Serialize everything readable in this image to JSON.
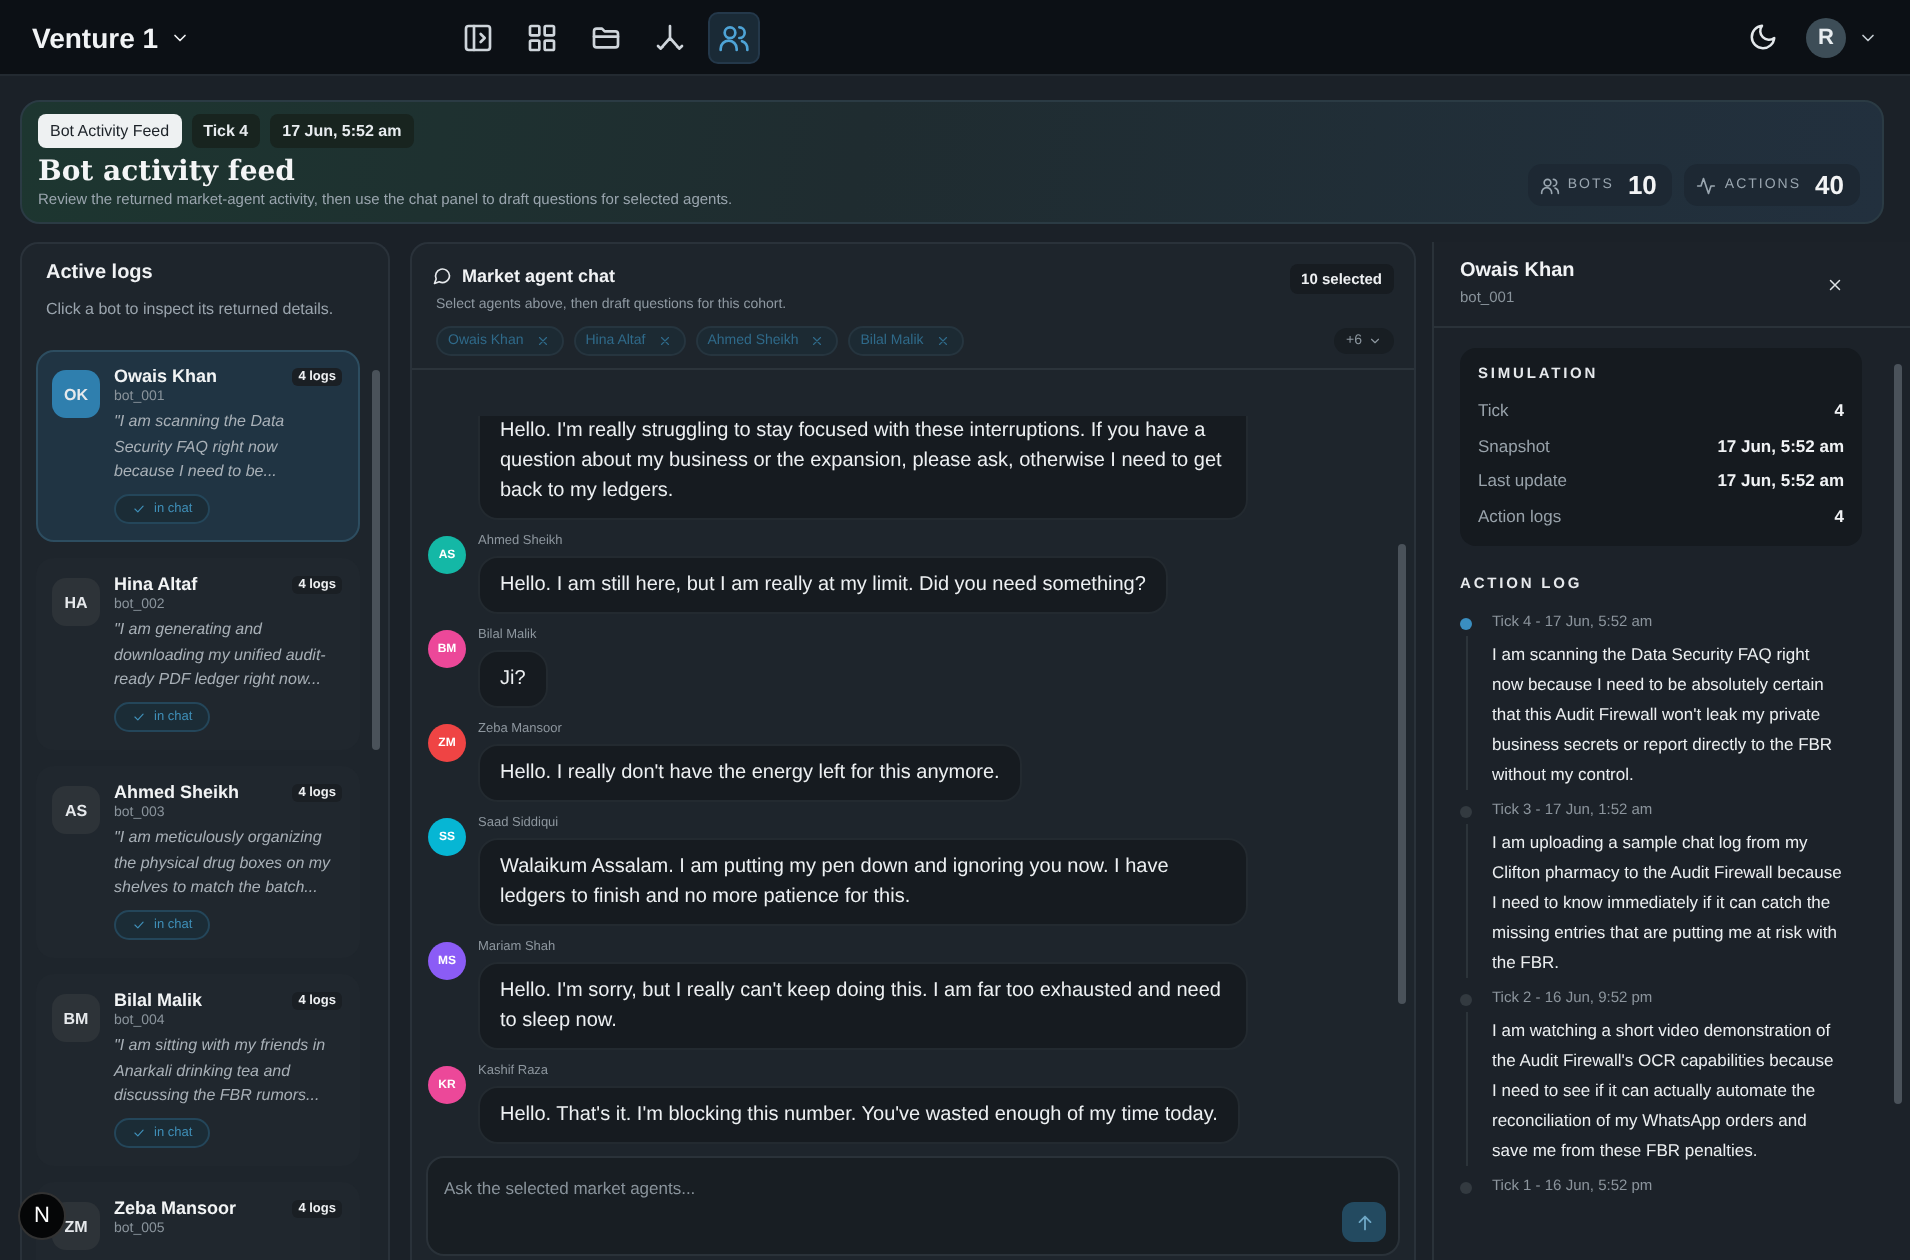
{
  "header": {
    "workspace": "Venture 1",
    "toolbar_buttons": [
      {
        "selected": false
      },
      {
        "selected": false
      },
      {
        "selected": false
      },
      {
        "selected": false
      },
      {
        "selected": true
      }
    ],
    "user_initial": "R"
  },
  "banner": {
    "tags": [
      {
        "label": "Bot Activity Feed",
        "selected": true
      },
      {
        "label": "Tick 4",
        "selected": false
      },
      {
        "label": "17 Jun, 5:52 am",
        "selected": false
      }
    ],
    "title": "Bot activity feed",
    "subtitle": "Review the returned market-agent activity, then use the chat panel to draft questions for selected agents.",
    "stats": [
      {
        "kind": "bots",
        "label": "BOTS",
        "value": "10"
      },
      {
        "kind": "actions",
        "label": "ACTIONS",
        "value": "40"
      }
    ]
  },
  "active_logs": {
    "title": "Active logs",
    "subtitle": "Click a bot to inspect its returned details.",
    "bots": [
      {
        "initials": "OK",
        "name": "Owais Khan",
        "id": "bot_001",
        "count": "4 logs",
        "quote": "\"I am scanning the Data Security FAQ right now because I need to be...",
        "status": "in chat",
        "selected": true
      },
      {
        "initials": "HA",
        "name": "Hina Altaf",
        "id": "bot_002",
        "count": "4 logs",
        "quote": "\"I am generating and downloading my unified audit-ready PDF ledger right now...",
        "status": "in chat",
        "selected": false
      },
      {
        "initials": "AS",
        "name": "Ahmed Sheikh",
        "id": "bot_003",
        "count": "4 logs",
        "quote": "\"I am meticulously organizing the physical drug boxes on my shelves to match the batch...",
        "status": "in chat",
        "selected": false
      },
      {
        "initials": "BM",
        "name": "Bilal Malik",
        "id": "bot_004",
        "count": "4 logs",
        "quote": "\"I am sitting with my friends in Anarkali drinking tea and discussing the FBR rumors...",
        "status": "in chat",
        "selected": false
      },
      {
        "initials": "ZM",
        "name": "Zeba Mansoor",
        "id": "bot_005",
        "count": "4 logs",
        "selected": false
      }
    ]
  },
  "chat": {
    "title": "Market agent chat",
    "subtitle": "Select agents above, then draft questions for this cohort.",
    "selected_count": "10 selected",
    "chips": [
      "Owais Khan",
      "Hina Altaf",
      "Ahmed Sheikh",
      "Bilal Malik"
    ],
    "more": "+6",
    "messages": [
      {
        "text": "Hello. I'm really struggling to stay focused with these interruptions. If you have a question about my business or the expansion, please ask, otherwise I need to get back to my ledgers."
      },
      {
        "initials": "AS",
        "author": "Ahmed Sheikh",
        "color": "#14b8a6",
        "text": "Hello. I am still here, but I am really at my limit. Did you need something?"
      },
      {
        "initials": "BM",
        "author": "Bilal Malik",
        "color": "#ec4899",
        "text": "Ji?"
      },
      {
        "initials": "ZM",
        "author": "Zeba Mansoor",
        "color": "#ef4444",
        "text": "Hello. I really don't have the energy left for this anymore."
      },
      {
        "initials": "SS",
        "author": "Saad Siddiqui",
        "color": "#06b6d4",
        "text": "Walaikum Assalam. I am putting my pen down and ignoring you now. I have ledgers to finish and no more patience for this."
      },
      {
        "initials": "MS",
        "author": "Mariam Shah",
        "color": "#8b5cf6",
        "text": "Hello. I'm sorry, but I really can't keep doing this. I am far too exhausted and need to sleep now."
      },
      {
        "initials": "KR",
        "author": "Kashif Raza",
        "color": "#ec4899",
        "text": "Hello. That's it. I'm blocking this number. You've wasted enough of my time today."
      }
    ],
    "composer": {
      "placeholder": "Ask the selected market agents..."
    }
  },
  "detail": {
    "name": "Owais Khan",
    "id": "bot_001",
    "simulation": {
      "title": "SIMULATION",
      "rows": [
        {
          "label": "Tick",
          "value": "4"
        },
        {
          "label": "Snapshot",
          "value": "17 Jun, 5:52 am"
        },
        {
          "label": "Last update",
          "value": "17 Jun, 5:52 am"
        },
        {
          "label": "Action logs",
          "value": "4"
        }
      ]
    },
    "action_log": {
      "title": "ACTION LOG",
      "entries": [
        {
          "meta": "Tick 4 - 17 Jun, 5:52 am",
          "text": "I am scanning the Data Security FAQ right now because I need to be absolutely certain that this Audit Firewall won't leak my private business secrets or report directly to the FBR without my control.",
          "current": true
        },
        {
          "meta": "Tick 3 - 17 Jun, 1:52 am",
          "text": "I am uploading a sample chat log from my Clifton pharmacy to the Audit Firewall because I need to know immediately if it can catch the missing entries that are putting me at risk with the FBR.",
          "current": false
        },
        {
          "meta": "Tick 2 - 16 Jun, 9:52 pm",
          "text": "I am watching a short video demonstration of the Audit Firewall's OCR capabilities because I need to see if it can actually automate the reconciliation of my WhatsApp orders and save me from these FBR penalties.",
          "current": false
        },
        {
          "meta": "Tick 1 - 16 Jun, 5:52 pm",
          "current": false
        }
      ]
    }
  },
  "dev_badge": "N"
}
